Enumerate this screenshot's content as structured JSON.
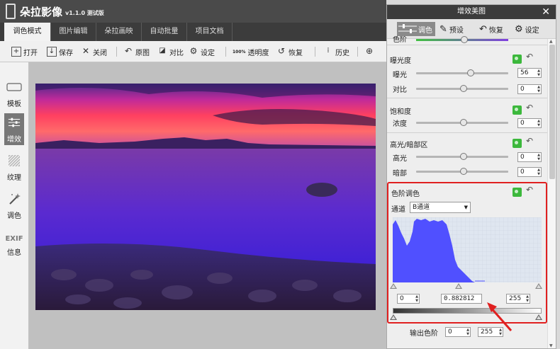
{
  "app": {
    "title": "朵拉影像",
    "version": "v1.1.0 测试版"
  },
  "tabs": [
    "调色模式",
    "图片编辑",
    "朵拉画映",
    "自动批量",
    "项目文档"
  ],
  "toolbar": {
    "open": "打开",
    "save": "保存",
    "close": "关闭",
    "original": "原图",
    "compare": "对比",
    "settings": "设定",
    "opacity": "透明度",
    "restore": "恢复",
    "history": "历史",
    "opacity_badge": "100%"
  },
  "sidebar": [
    {
      "label": "模板",
      "icon": "template-icon"
    },
    {
      "label": "增效",
      "icon": "enhance-icon"
    },
    {
      "label": "纹理",
      "icon": "texture-icon"
    },
    {
      "label": "调色",
      "icon": "magic-wand-icon"
    },
    {
      "label": "信息",
      "icon": "exif-icon",
      "icon_text": "EXIF"
    }
  ],
  "panel": {
    "title": "增效美图",
    "tabs": [
      "调色",
      "预设",
      "恢复",
      "设定"
    ],
    "cut_label": "色阶",
    "exposure": {
      "title": "曝光度",
      "rows": [
        {
          "label": "曝光",
          "value": "56",
          "pos": 0.6
        },
        {
          "label": "对比",
          "value": "0",
          "pos": 0.5
        }
      ]
    },
    "saturation": {
      "title": "饱和度",
      "rows": [
        {
          "label": "浓度",
          "value": "0",
          "pos": 0.5
        }
      ]
    },
    "highlight": {
      "title": "高光/暗部区",
      "rows": [
        {
          "label": "高光",
          "value": "0",
          "pos": 0.5
        },
        {
          "label": "暗部",
          "value": "0",
          "pos": 0.5
        }
      ]
    },
    "levels": {
      "title": "色阶调色",
      "channel_label": "通道",
      "channel_value": "B通道",
      "input_low": "0",
      "input_gamma": "0.882812",
      "input_high": "255",
      "output_label": "输出色阶",
      "output_low": "0",
      "output_high": "255"
    }
  },
  "colors": {
    "accent_red": "#e02020",
    "histogram": "#5050ff",
    "toggle_green": "#3cb83c"
  }
}
